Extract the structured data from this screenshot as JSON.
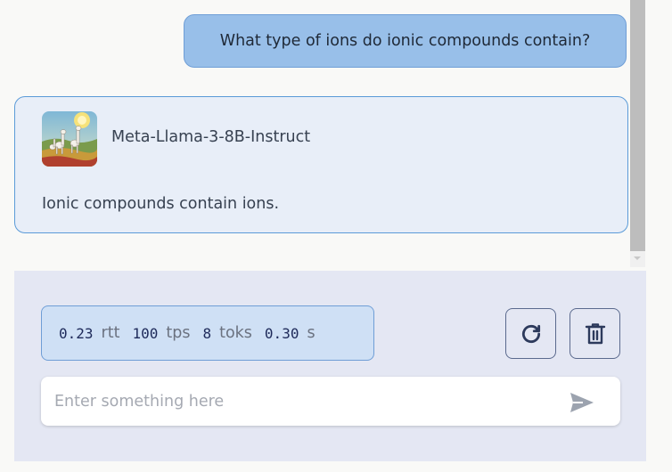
{
  "conversation": {
    "user_message": "What type of ions do ionic compounds contain?",
    "bot": {
      "model_name": "Meta-Llama-3-8B-Instruct",
      "message": "Ionic compounds contain ions.",
      "avatar_icon": "llama-avatar-icon"
    }
  },
  "stats": {
    "rtt_value": "0.23",
    "rtt_unit": "rtt",
    "tps_value": "100",
    "tps_unit": "tps",
    "toks_value": "8",
    "toks_unit": "toks",
    "time_value": "0.30",
    "time_unit": "s"
  },
  "buttons": {
    "regenerate_icon": "refresh-icon",
    "delete_icon": "trash-icon",
    "send_icon": "send-icon"
  },
  "input": {
    "value": "",
    "placeholder": "Enter something here"
  },
  "colors": {
    "user_bubble": "#98bfe9",
    "bot_bubble": "#e8eef8",
    "controls_bg": "#e4e7f3",
    "stats_bg": "#cfe0f5",
    "icon_color": "#2d3a5c"
  }
}
